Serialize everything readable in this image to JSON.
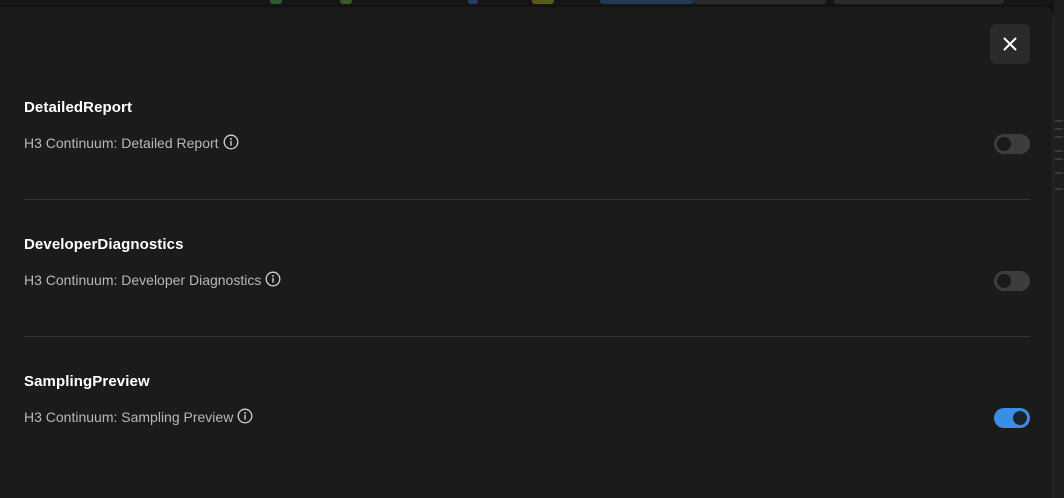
{
  "dialog": {
    "close_icon": "close-icon",
    "sections": [
      {
        "title": "DetailedReport",
        "setting_label": "H3 Continuum: Detailed Report",
        "info_icon": "info-icon",
        "enabled": false
      },
      {
        "title": "DeveloperDiagnostics",
        "setting_label": "H3 Continuum: Developer Diagnostics",
        "info_icon": "info-icon",
        "enabled": false
      },
      {
        "title": "SamplingPreview",
        "setting_label": "H3 Continuum: Sampling Preview",
        "info_icon": "info-icon",
        "enabled": true
      }
    ]
  },
  "colors": {
    "toggle_on": "#3a8ee6",
    "toggle_off": "#3d3d3d",
    "panel_bg": "#1b1b1b"
  }
}
